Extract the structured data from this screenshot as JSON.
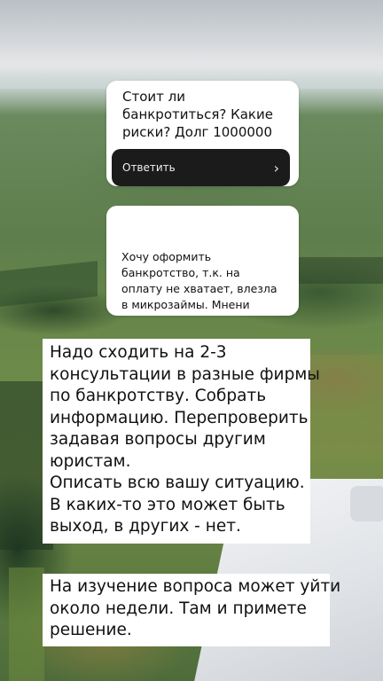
{
  "question_card_1": {
    "lines": [
      "Стоит ли",
      "банкротиться? Какие",
      "риски? Долг 1000000"
    ],
    "answer_button_label": "Ответить",
    "answer_icon": "chevron-right-icon"
  },
  "question_card_2": {
    "lines": [
      "Хочу оформить",
      "банкротство, т.к. на",
      "оплату не хватает, влезла",
      "в микрозаймы. Мнени"
    ]
  },
  "caption_1": {
    "lines": [
      "Надо сходить на 2-3",
      "консультации в разные фирмы",
      "по банкротству. Собрать",
      "информацию. Перепроверить",
      "задавая вопросы другим",
      "юристам.",
      "Описать всю вашу ситуацию.",
      "В каких-то это может быть",
      "выход, в других - нет."
    ]
  },
  "caption_2": {
    "lines": [
      "На изучение вопроса может уйти",
      "около недели. Там и примете",
      "решение."
    ]
  },
  "colors": {
    "card_bg": "#ffffff",
    "answer_bar_bg": "#1b1b1b",
    "caption_bg": "#ffffff",
    "text": "#111111"
  }
}
